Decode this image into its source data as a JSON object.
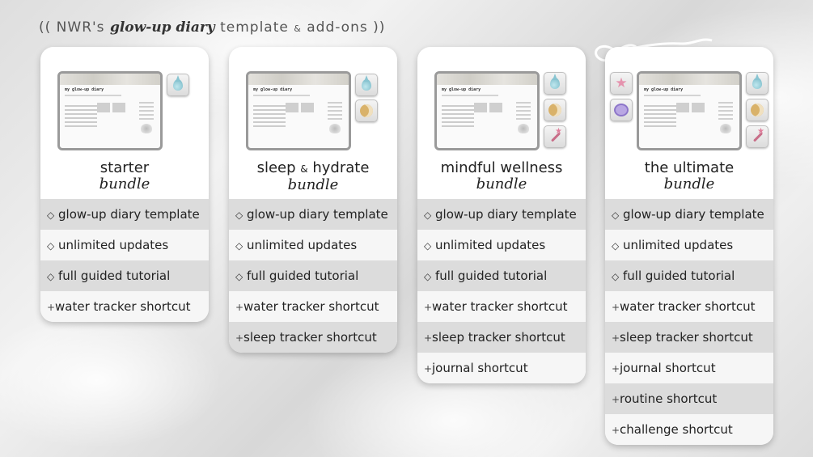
{
  "header": {
    "prefix": "(( NWR's ",
    "script": "glow-up diary",
    "middle": " template ",
    "amp": "&",
    "suffix": " add-ons ))"
  },
  "preview": {
    "title": "my glow-up diary"
  },
  "cards": [
    {
      "title": "starter",
      "subtitle": "bundle",
      "icons": [
        "water-drop-icon"
      ],
      "rows": [
        {
          "marker": "◇",
          "text": "glow-up diary template"
        },
        {
          "marker": "◇",
          "text": "unlimited updates"
        },
        {
          "marker": "◇",
          "text": "full guided tutorial"
        },
        {
          "marker": "+",
          "text": "water tracker shortcut"
        }
      ]
    },
    {
      "title_a": "sleep",
      "title_amp": "&",
      "title_b": "hydrate",
      "subtitle": "bundle",
      "icons": [
        "water-drop-icon",
        "moon-icon"
      ],
      "rows": [
        {
          "marker": "◇",
          "text": "glow-up diary template"
        },
        {
          "marker": "◇",
          "text": "unlimited updates"
        },
        {
          "marker": "◇",
          "text": "full guided tutorial"
        },
        {
          "marker": "+",
          "text": "water tracker shortcut"
        },
        {
          "marker": "+",
          "text": "sleep tracker shortcut"
        }
      ]
    },
    {
      "title": "mindful wellness",
      "subtitle": "bundle",
      "icons": [
        "water-drop-icon",
        "moon-icon",
        "pen-icon"
      ],
      "rows": [
        {
          "marker": "◇",
          "text": "glow-up diary template"
        },
        {
          "marker": "◇",
          "text": "unlimited updates"
        },
        {
          "marker": "◇",
          "text": "full guided tutorial"
        },
        {
          "marker": "+",
          "text": "water tracker shortcut"
        },
        {
          "marker": "+",
          "text": "sleep tracker shortcut"
        },
        {
          "marker": "+",
          "text": "journal shortcut"
        }
      ]
    },
    {
      "title": "the ultimate",
      "subtitle": "bundle",
      "icons": [
        "water-drop-icon",
        "moon-icon",
        "pen-icon",
        "star-icon",
        "ring-icon"
      ],
      "rows": [
        {
          "marker": "◇",
          "text": "glow-up diary template"
        },
        {
          "marker": "◇",
          "text": "unlimited updates"
        },
        {
          "marker": "◇",
          "text": "full guided tutorial"
        },
        {
          "marker": "+",
          "text": "water tracker shortcut"
        },
        {
          "marker": "+",
          "text": "sleep tracker shortcut"
        },
        {
          "marker": "+",
          "text": "journal shortcut"
        },
        {
          "marker": "+",
          "text": "routine shortcut"
        },
        {
          "marker": "+",
          "text": "challenge shortcut"
        }
      ]
    }
  ]
}
